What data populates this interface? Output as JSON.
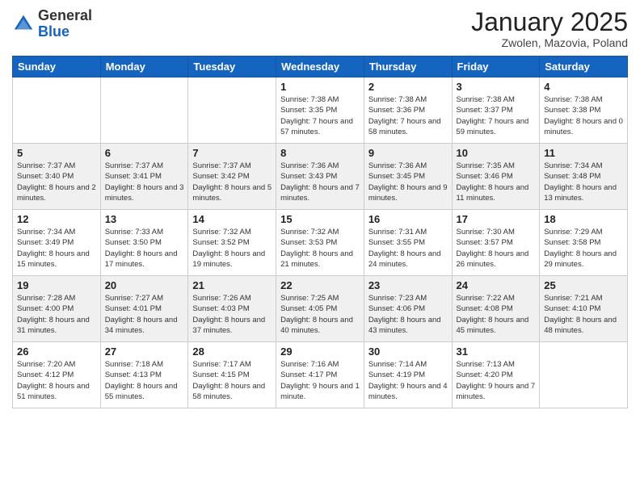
{
  "header": {
    "logo_general": "General",
    "logo_blue": "Blue",
    "month_title": "January 2025",
    "subtitle": "Zwolen, Mazovia, Poland"
  },
  "weekdays": [
    "Sunday",
    "Monday",
    "Tuesday",
    "Wednesday",
    "Thursday",
    "Friday",
    "Saturday"
  ],
  "weeks": [
    [
      {
        "day": "",
        "info": ""
      },
      {
        "day": "",
        "info": ""
      },
      {
        "day": "",
        "info": ""
      },
      {
        "day": "1",
        "info": "Sunrise: 7:38 AM\nSunset: 3:35 PM\nDaylight: 7 hours and 57 minutes."
      },
      {
        "day": "2",
        "info": "Sunrise: 7:38 AM\nSunset: 3:36 PM\nDaylight: 7 hours and 58 minutes."
      },
      {
        "day": "3",
        "info": "Sunrise: 7:38 AM\nSunset: 3:37 PM\nDaylight: 7 hours and 59 minutes."
      },
      {
        "day": "4",
        "info": "Sunrise: 7:38 AM\nSunset: 3:38 PM\nDaylight: 8 hours and 0 minutes."
      }
    ],
    [
      {
        "day": "5",
        "info": "Sunrise: 7:37 AM\nSunset: 3:40 PM\nDaylight: 8 hours and 2 minutes."
      },
      {
        "day": "6",
        "info": "Sunrise: 7:37 AM\nSunset: 3:41 PM\nDaylight: 8 hours and 3 minutes."
      },
      {
        "day": "7",
        "info": "Sunrise: 7:37 AM\nSunset: 3:42 PM\nDaylight: 8 hours and 5 minutes."
      },
      {
        "day": "8",
        "info": "Sunrise: 7:36 AM\nSunset: 3:43 PM\nDaylight: 8 hours and 7 minutes."
      },
      {
        "day": "9",
        "info": "Sunrise: 7:36 AM\nSunset: 3:45 PM\nDaylight: 8 hours and 9 minutes."
      },
      {
        "day": "10",
        "info": "Sunrise: 7:35 AM\nSunset: 3:46 PM\nDaylight: 8 hours and 11 minutes."
      },
      {
        "day": "11",
        "info": "Sunrise: 7:34 AM\nSunset: 3:48 PM\nDaylight: 8 hours and 13 minutes."
      }
    ],
    [
      {
        "day": "12",
        "info": "Sunrise: 7:34 AM\nSunset: 3:49 PM\nDaylight: 8 hours and 15 minutes."
      },
      {
        "day": "13",
        "info": "Sunrise: 7:33 AM\nSunset: 3:50 PM\nDaylight: 8 hours and 17 minutes."
      },
      {
        "day": "14",
        "info": "Sunrise: 7:32 AM\nSunset: 3:52 PM\nDaylight: 8 hours and 19 minutes."
      },
      {
        "day": "15",
        "info": "Sunrise: 7:32 AM\nSunset: 3:53 PM\nDaylight: 8 hours and 21 minutes."
      },
      {
        "day": "16",
        "info": "Sunrise: 7:31 AM\nSunset: 3:55 PM\nDaylight: 8 hours and 24 minutes."
      },
      {
        "day": "17",
        "info": "Sunrise: 7:30 AM\nSunset: 3:57 PM\nDaylight: 8 hours and 26 minutes."
      },
      {
        "day": "18",
        "info": "Sunrise: 7:29 AM\nSunset: 3:58 PM\nDaylight: 8 hours and 29 minutes."
      }
    ],
    [
      {
        "day": "19",
        "info": "Sunrise: 7:28 AM\nSunset: 4:00 PM\nDaylight: 8 hours and 31 minutes."
      },
      {
        "day": "20",
        "info": "Sunrise: 7:27 AM\nSunset: 4:01 PM\nDaylight: 8 hours and 34 minutes."
      },
      {
        "day": "21",
        "info": "Sunrise: 7:26 AM\nSunset: 4:03 PM\nDaylight: 8 hours and 37 minutes."
      },
      {
        "day": "22",
        "info": "Sunrise: 7:25 AM\nSunset: 4:05 PM\nDaylight: 8 hours and 40 minutes."
      },
      {
        "day": "23",
        "info": "Sunrise: 7:23 AM\nSunset: 4:06 PM\nDaylight: 8 hours and 43 minutes."
      },
      {
        "day": "24",
        "info": "Sunrise: 7:22 AM\nSunset: 4:08 PM\nDaylight: 8 hours and 45 minutes."
      },
      {
        "day": "25",
        "info": "Sunrise: 7:21 AM\nSunset: 4:10 PM\nDaylight: 8 hours and 48 minutes."
      }
    ],
    [
      {
        "day": "26",
        "info": "Sunrise: 7:20 AM\nSunset: 4:12 PM\nDaylight: 8 hours and 51 minutes."
      },
      {
        "day": "27",
        "info": "Sunrise: 7:18 AM\nSunset: 4:13 PM\nDaylight: 8 hours and 55 minutes."
      },
      {
        "day": "28",
        "info": "Sunrise: 7:17 AM\nSunset: 4:15 PM\nDaylight: 8 hours and 58 minutes."
      },
      {
        "day": "29",
        "info": "Sunrise: 7:16 AM\nSunset: 4:17 PM\nDaylight: 9 hours and 1 minute."
      },
      {
        "day": "30",
        "info": "Sunrise: 7:14 AM\nSunset: 4:19 PM\nDaylight: 9 hours and 4 minutes."
      },
      {
        "day": "31",
        "info": "Sunrise: 7:13 AM\nSunset: 4:20 PM\nDaylight: 9 hours and 7 minutes."
      },
      {
        "day": "",
        "info": ""
      }
    ]
  ]
}
